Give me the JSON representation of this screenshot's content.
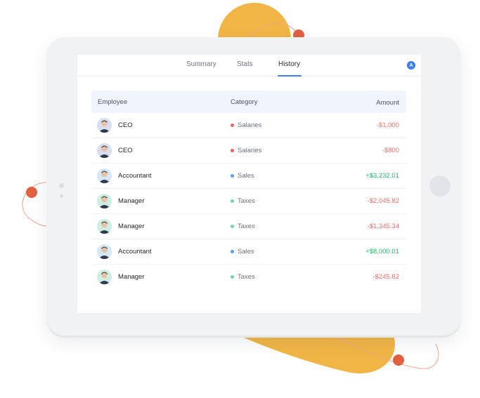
{
  "tabs": [
    {
      "label": "Summary"
    },
    {
      "label": "Stats"
    },
    {
      "label": "History"
    }
  ],
  "active_tab": "History",
  "user_avatar_initial": "A",
  "columns": {
    "employee": "Employee",
    "category": "Category",
    "amount": "Amount"
  },
  "rows": [
    {
      "employee": "CEO",
      "category": "Salaries",
      "amount": "-$1,000"
    },
    {
      "employee": "CEO",
      "category": "Salaries",
      "amount": "-$800"
    },
    {
      "employee": "Accountant",
      "category": "Sales",
      "amount": "+$3,232.01"
    },
    {
      "employee": "Manager",
      "category": "Taxes",
      "amount": "-$2,045.82"
    },
    {
      "employee": "Manager",
      "category": "Taxes",
      "amount": "-$1,345.34"
    },
    {
      "employee": "Accountant",
      "category": "Sales",
      "amount": "+$8,000.01"
    },
    {
      "employee": "Manager",
      "category": "Taxes",
      "amount": "-$245.82"
    }
  ],
  "colors": {
    "accent": "#3d7df0",
    "negative_amount": "#f0706a",
    "positive_amount": "#27b872",
    "category_salaries": "#f0625e",
    "category_sales": "#5a9ef5",
    "category_taxes": "#6fd3a8",
    "decor_yellow": "#f0b545",
    "decor_orange": "#e06040"
  }
}
